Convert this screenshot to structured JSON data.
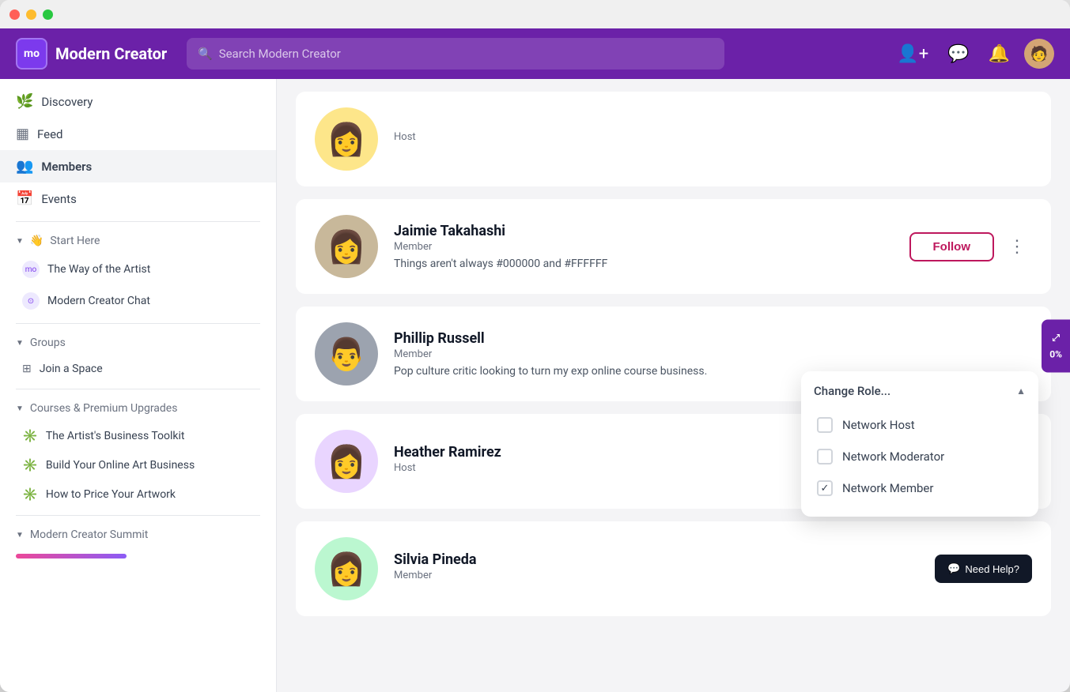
{
  "window": {
    "title": "Modern Creator"
  },
  "header": {
    "brand_logo": "mo",
    "brand_name": "Modern Creator",
    "search_placeholder": "Search Modern Creator",
    "icons": {
      "add_user": "👤+",
      "chat": "💬",
      "bell": "🔔"
    }
  },
  "sidebar": {
    "nav_items": [
      {
        "id": "discovery",
        "icon": "🌿",
        "label": "Discovery",
        "active": false
      },
      {
        "id": "feed",
        "icon": "▦",
        "label": "Feed",
        "active": false
      },
      {
        "id": "members",
        "icon": "👥",
        "label": "Members",
        "active": true
      },
      {
        "id": "events",
        "icon": "📅",
        "label": "Events",
        "active": false
      }
    ],
    "sections": [
      {
        "id": "start-here",
        "label": "Start Here",
        "emoji": "👋",
        "expanded": true,
        "items": [
          {
            "id": "way-of-artist",
            "icon_color": "#7c3aed",
            "label": "The Way of the Artist"
          },
          {
            "id": "modern-creator-chat",
            "icon_color": "#7c3aed",
            "label": "Modern Creator Chat"
          }
        ]
      },
      {
        "id": "groups",
        "label": "Groups",
        "expanded": true,
        "items": [
          {
            "id": "join-space",
            "icon": "⊞",
            "label": "Join a Space"
          }
        ]
      },
      {
        "id": "courses",
        "label": "Courses & Premium Upgrades",
        "expanded": true,
        "items": [
          {
            "id": "artists-business-toolkit",
            "label": "The Artist's Business Toolkit",
            "icon_type": "sun"
          },
          {
            "id": "build-online-art",
            "label": "Build Your Online Art Business",
            "icon_type": "sun2"
          },
          {
            "id": "price-artwork",
            "label": "How to Price Your Artwork",
            "icon_type": "sun3"
          }
        ]
      },
      {
        "id": "modern-creator-summit",
        "label": "Modern Creator Summit",
        "expanded": true,
        "items": []
      }
    ]
  },
  "members": [
    {
      "id": "host-top",
      "name": "",
      "role": "Host",
      "bio": "",
      "avatar_color": "#d4a574",
      "avatar_emoji": "👩"
    },
    {
      "id": "jaimie-takahashi",
      "name": "Jaimie Takahashi",
      "role": "Member",
      "bio": "Things aren't always #000000 and #FFFFFF",
      "avatar_color": "#c4b5a0",
      "avatar_emoji": "👩"
    },
    {
      "id": "phillip-russell",
      "name": "Phillip Russell",
      "role": "Member",
      "bio": "Pop culture critic looking to turn my exp online course business.",
      "avatar_color": "#8b8b8b",
      "avatar_emoji": "👨"
    },
    {
      "id": "heather-ramirez",
      "name": "Heather Ramirez",
      "role": "Host",
      "bio": "",
      "avatar_color": "#9b59b6",
      "avatar_emoji": "👩"
    },
    {
      "id": "silvia-pineda",
      "name": "Silvia Pineda",
      "role": "Member",
      "bio": "",
      "avatar_color": "#6ab04c",
      "avatar_emoji": "👩"
    }
  ],
  "follow_button": "Follow",
  "dropdown": {
    "title": "Change Role...",
    "options": [
      {
        "id": "network-host",
        "label": "Network Host",
        "checked": false
      },
      {
        "id": "network-moderator",
        "label": "Network Moderator",
        "checked": false
      },
      {
        "id": "network-member",
        "label": "Network Member",
        "checked": true
      }
    ]
  },
  "float_button": {
    "icon": "⤢",
    "label": "0%"
  },
  "need_help": "Need Help?"
}
